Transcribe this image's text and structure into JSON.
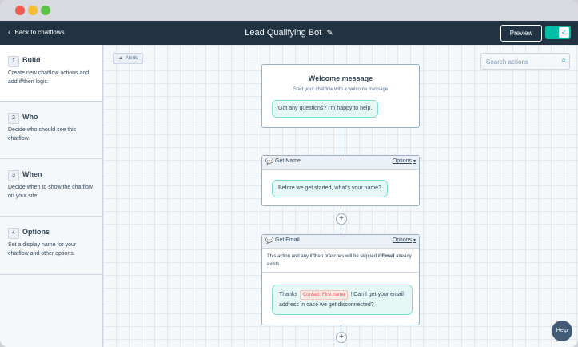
{
  "window": {
    "title_bar_colors": {
      "close": "#ee5a52",
      "minimize": "#f5bd32",
      "maximize": "#5bc345"
    }
  },
  "header": {
    "back_label": "Back to chatflows",
    "back_icon": "chevron-left-icon",
    "title": "Lead Qualifying Bot",
    "title_icon": "pencil-icon",
    "preview_label": "Preview",
    "toggle_state": "on",
    "accent": "#00bda5",
    "background": "#213343"
  },
  "sidebar": {
    "steps": [
      {
        "number": "1",
        "title": "Build",
        "description": "Create new chatflow actions and add if/then logic."
      },
      {
        "number": "2",
        "title": "Who",
        "description": "Decide who should see this chatflow."
      },
      {
        "number": "3",
        "title": "When",
        "description": "Decide when to show the chatflow on your site."
      },
      {
        "number": "4",
        "title": "Options",
        "description": "Set a display name for your chatflow and other options."
      }
    ]
  },
  "canvas": {
    "alerts_label": "Alerts",
    "search_placeholder": "Search actions",
    "welcome": {
      "title": "Welcome message",
      "subtitle": "Start your chatflow with a welcome message",
      "message": "Got any questions? I'm happy to help."
    },
    "get_name": {
      "label": "Get Name",
      "options_label": "Options",
      "message": "Before we get started, what's your name?"
    },
    "get_email": {
      "label": "Get Email",
      "options_label": "Options",
      "note_before": "This action and any if/then branches will be skipped if",
      "note_bold": "Email",
      "note_after": "already exists.",
      "message_before": "Thanks",
      "token": "Contact: First name",
      "message_after": "! Can I get your email address in case we get disconnected?"
    },
    "add_step_symbol": "+",
    "help_label": "Help"
  }
}
